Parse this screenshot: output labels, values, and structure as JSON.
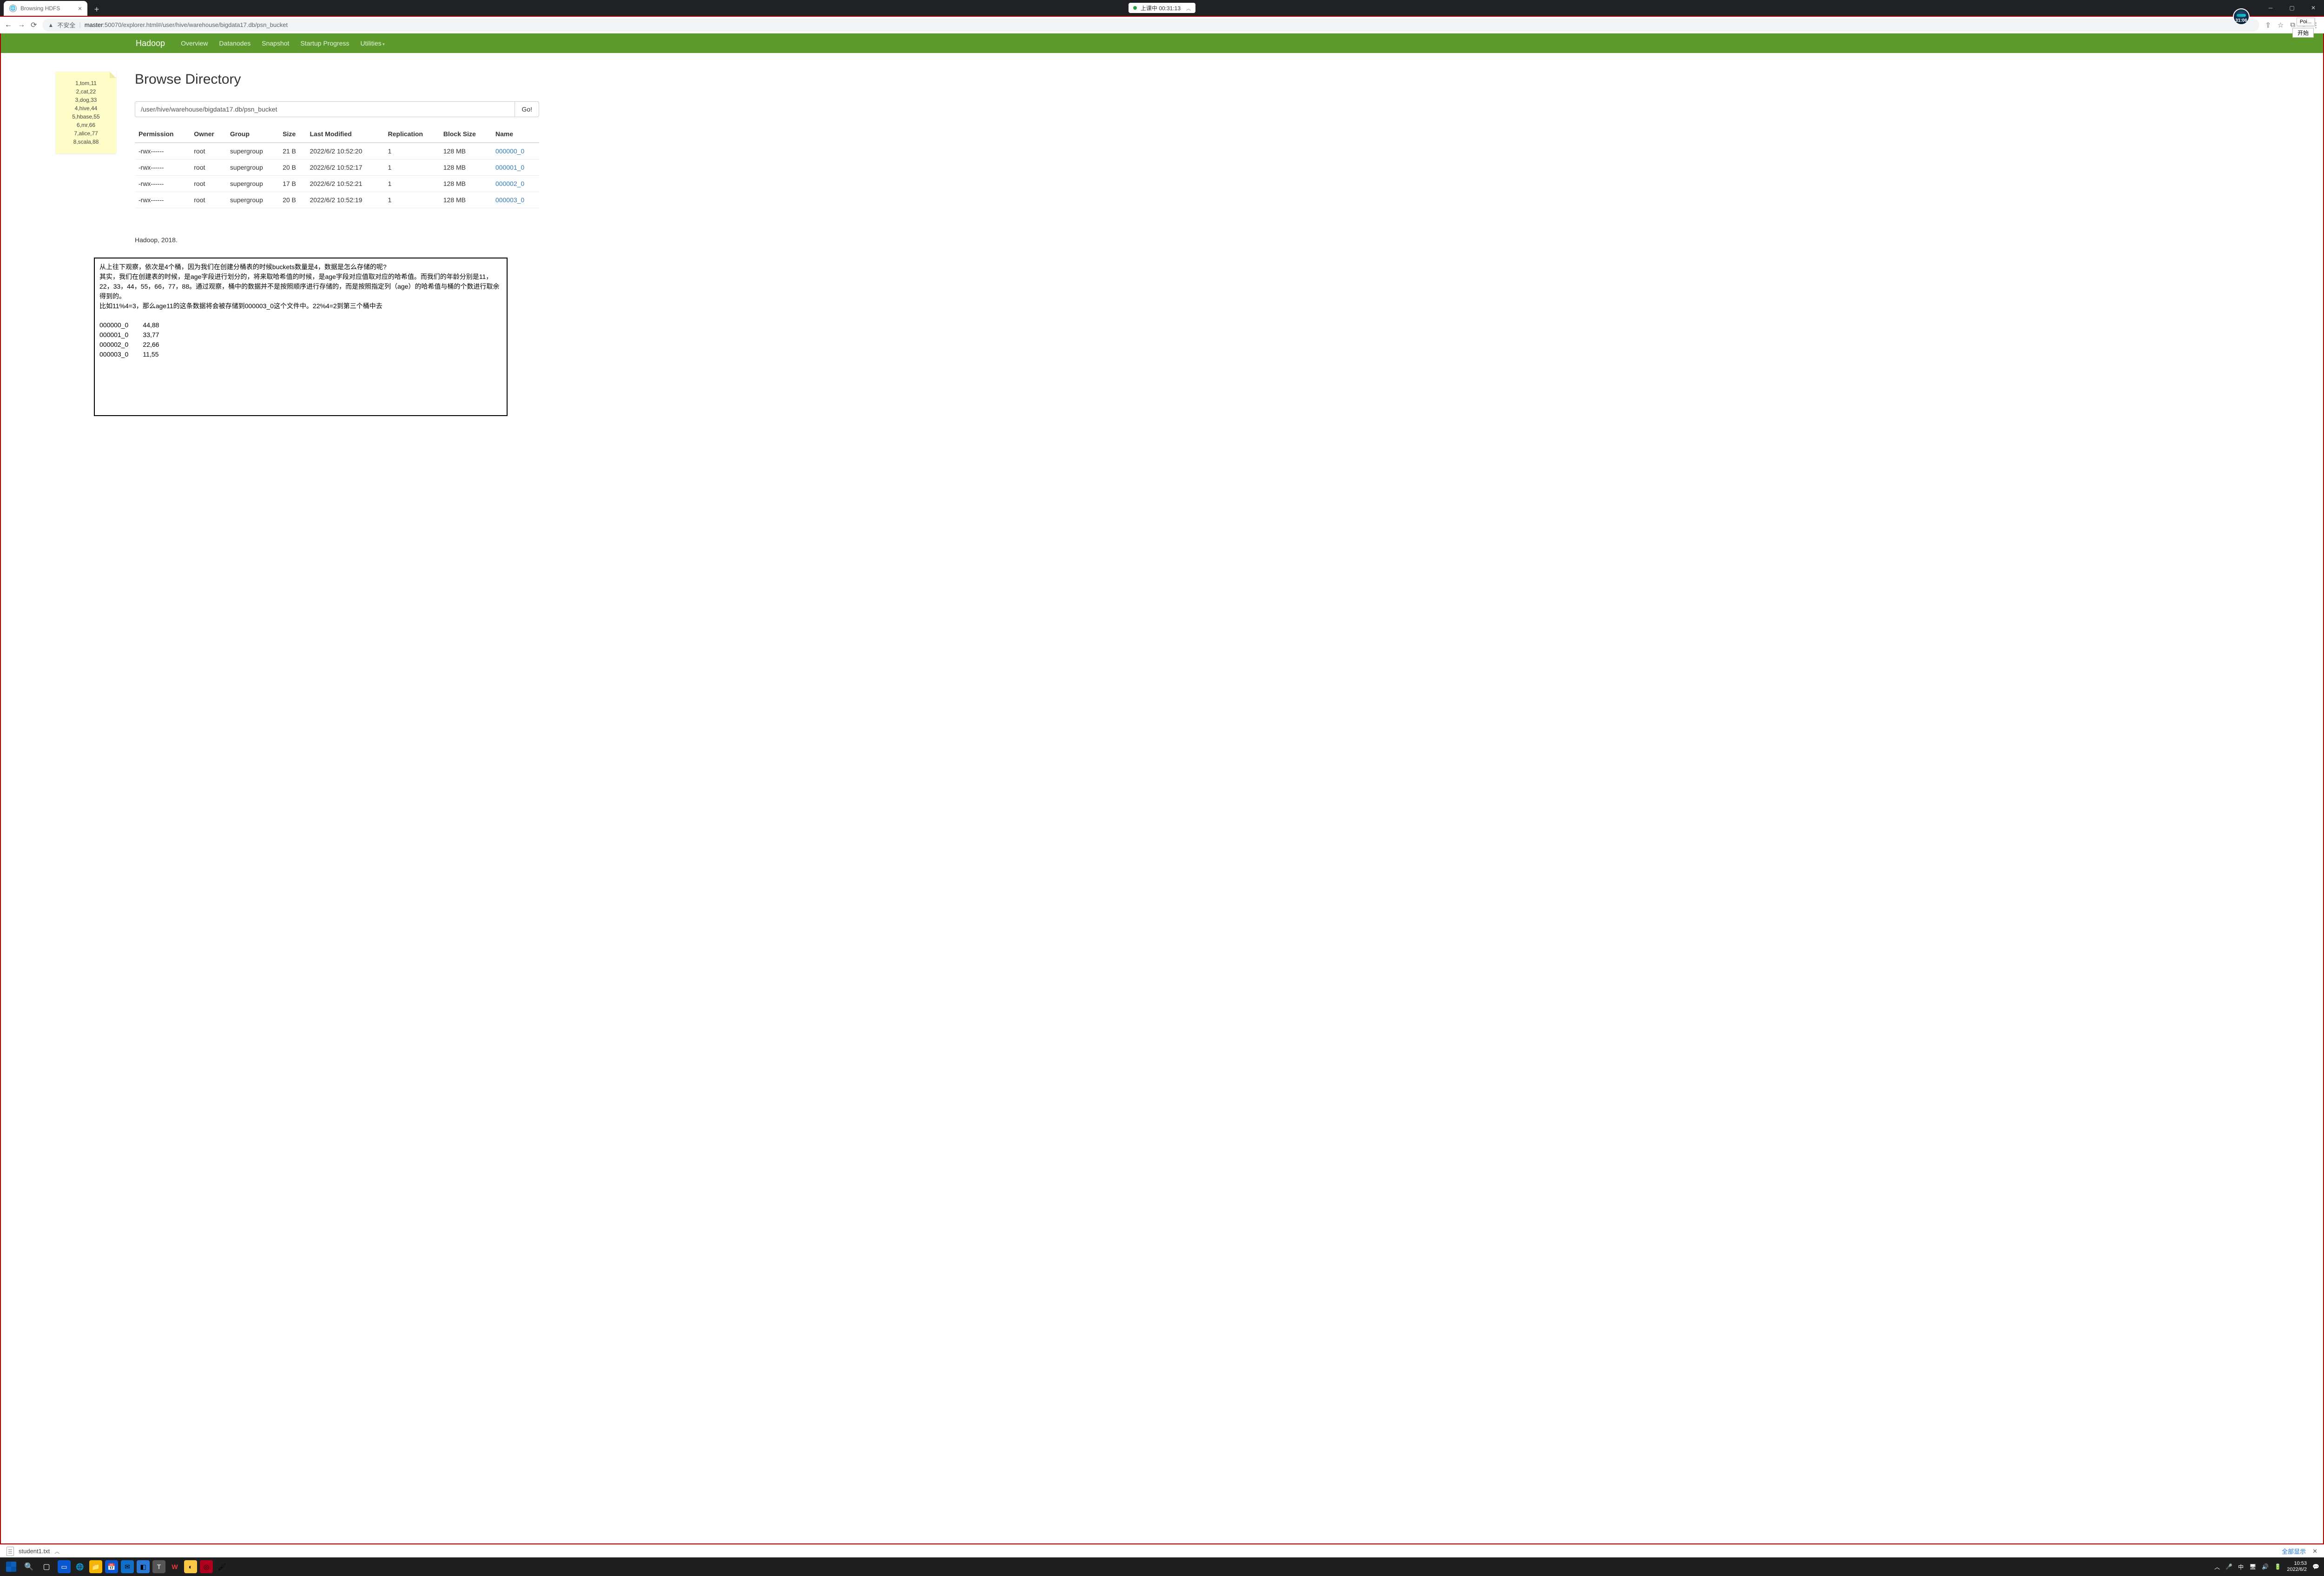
{
  "browser": {
    "tab_title": "Browsing HDFS",
    "not_secure": "不安全",
    "url_host": "master",
    "url_rest": ":50070/explorer.html#/user/hive/warehouse/bigdata17.db/psn_bucket",
    "recording_label": "上课中 00:31:13",
    "avatar_time": "31:06",
    "tooltip": "Poi...",
    "start_btn": "开始"
  },
  "hadoop_nav": {
    "brand": "Hadoop",
    "links": [
      "Overview",
      "Datanodes",
      "Snapshot",
      "Startup Progress",
      "Utilities"
    ]
  },
  "sticky_note": [
    "1,tom,11",
    "2,cat,22",
    "3,dog,33",
    "4,hive,44",
    "5,hbase,55",
    "6,mr,66",
    "7,alice,77",
    "8,scala,88"
  ],
  "page_heading": "Browse Directory",
  "path_value": "/user/hive/warehouse/bigdata17.db/psn_bucket",
  "go_label": "Go!",
  "table": {
    "headers": [
      "Permission",
      "Owner",
      "Group",
      "Size",
      "Last Modified",
      "Replication",
      "Block Size",
      "Name"
    ],
    "rows": [
      {
        "perm": "-rwx------",
        "owner": "root",
        "group": "supergroup",
        "size": "21 B",
        "mod": "2022/6/2 10:52:20",
        "rep": "1",
        "bs": "128 MB",
        "name": "000000_0"
      },
      {
        "perm": "-rwx------",
        "owner": "root",
        "group": "supergroup",
        "size": "20 B",
        "mod": "2022/6/2 10:52:17",
        "rep": "1",
        "bs": "128 MB",
        "name": "000001_0"
      },
      {
        "perm": "-rwx------",
        "owner": "root",
        "group": "supergroup",
        "size": "17 B",
        "mod": "2022/6/2 10:52:21",
        "rep": "1",
        "bs": "128 MB",
        "name": "000002_0"
      },
      {
        "perm": "-rwx------",
        "owner": "root",
        "group": "supergroup",
        "size": "20 B",
        "mod": "2022/6/2 10:52:19",
        "rep": "1",
        "bs": "128 MB",
        "name": "000003_0"
      }
    ]
  },
  "footer": "Hadoop, 2018.",
  "annotation": {
    "p1": "从上往下观察，依次是4个桶，因为我们在创建分桶表的时候buckets数量是4，数据是怎么存储的呢?",
    "p2": "其实，我们在创建表的时候，是age字段进行划分的，将来取哈希值的时候，是age字段对应值取对应的哈希值。而我们的年龄分别是11，22，33，44，55，66，77，88。通过观察，桶中的数据并不是按照顺序进行存储的，而是按照指定列（age）的哈希值与桶的个数进行取余得到的。",
    "p3": "比如11%4=3，那么age11的这条数据将会被存储到000003_0这个文件中。22%4=2到第三个桶中去",
    "mapping": "000000_0        44,88\n000001_0        33,77\n000002_0        22,66\n000003_0        11,55"
  },
  "download": {
    "file": "student1.txt",
    "show_all": "全部显示"
  },
  "tray": {
    "time": "10:53",
    "date": "2022/6/2"
  }
}
